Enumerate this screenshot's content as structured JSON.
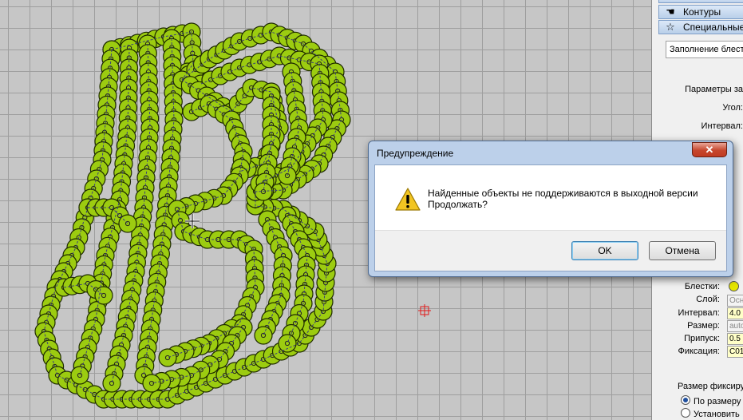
{
  "sidebar": {
    "categories": [
      {
        "label": "Контуры",
        "icon": "hand-icon"
      },
      {
        "label": "Специальные",
        "icon": "star-icon"
      }
    ],
    "fill_type_value": "Заполнение блестками",
    "params": {
      "section_label": "Параметры за",
      "angle_label": "Угол:",
      "interval_label": "Интервал:",
      "sequins_label": "Блестки:",
      "layer_label": "Слой:",
      "layer_value": "Осн",
      "interval2_label": "Интервал:",
      "interval2_value": "4.0",
      "size_label": "Размер:",
      "size_value": "auto",
      "allowance_label": "Припуск:",
      "allowance_value": "0.5",
      "fix_label": "Фиксация:",
      "fix_value": "C01"
    },
    "fix_size": {
      "label": "Размер фиксиру",
      "option1": "По размеру б",
      "option2": "Установить"
    }
  },
  "dialog": {
    "title": "Предупреждение",
    "close_label": "✕",
    "message_line1": "Найденные объекты не поддерживаются в выходной версии",
    "message_line2": "Продолжать?",
    "ok_label": "OK",
    "cancel_label": "Отмена"
  },
  "colors": {
    "sequin_fill": "#9ccc10",
    "sequin_outline": "#1e2a00",
    "canvas_bg": "#c6c6c6",
    "marker": "#e01818"
  }
}
